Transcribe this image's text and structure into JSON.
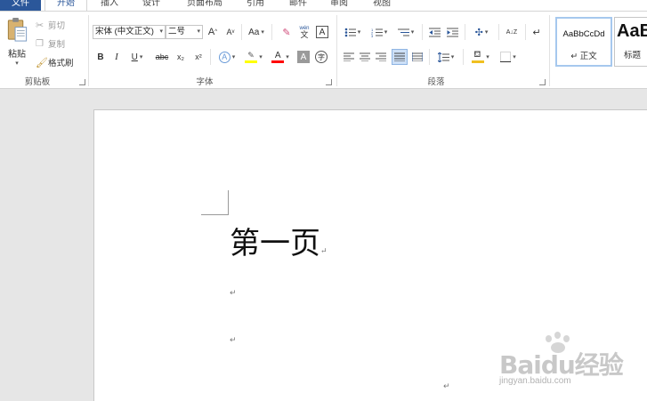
{
  "tabs": [
    {
      "label": "文件"
    },
    {
      "label": "开始"
    },
    {
      "label": "插入"
    },
    {
      "label": "设计"
    },
    {
      "label": "页面布局"
    },
    {
      "label": "引用"
    },
    {
      "label": "邮件"
    },
    {
      "label": "审阅"
    },
    {
      "label": "视图"
    }
  ],
  "clipboard": {
    "paste_label": "粘贴",
    "cut_label": "剪切",
    "copy_label": "复制",
    "format_painter_label": "格式刷",
    "group_label": "剪贴板"
  },
  "font": {
    "font_name": "宋体 (中文正文)",
    "font_size": "二号",
    "group_label": "字体",
    "grow_label": "A",
    "shrink_label": "A",
    "case_label": "Aa",
    "pinyin_label": "文",
    "border_char_label": "A",
    "bold_label": "B",
    "italic_label": "I",
    "underline_label": "U",
    "strike_label": "abc",
    "subscript_label": "x₂",
    "superscript_label": "x²",
    "effects_label": "A",
    "font_color_label": "A",
    "shading_label": "A",
    "enclose_label": "字"
  },
  "paragraph": {
    "group_label": "段落",
    "sort_label": "A↓Z"
  },
  "styles": {
    "normal_preview": "AaBbCcDd",
    "normal_label": "↵ 正文",
    "heading_preview": "AaB",
    "heading_label": "标题"
  },
  "document": {
    "heading_text": "第一页",
    "paragraph_mark": "↵"
  },
  "watermark": {
    "logo_text": "Baidu经验",
    "url_text": "jingyan.baidu.com"
  },
  "colors": {
    "file_tab_bg": "#2b579a",
    "accent": "#2b579a",
    "highlight": "#ffff00",
    "font_color": "#ff0000"
  }
}
